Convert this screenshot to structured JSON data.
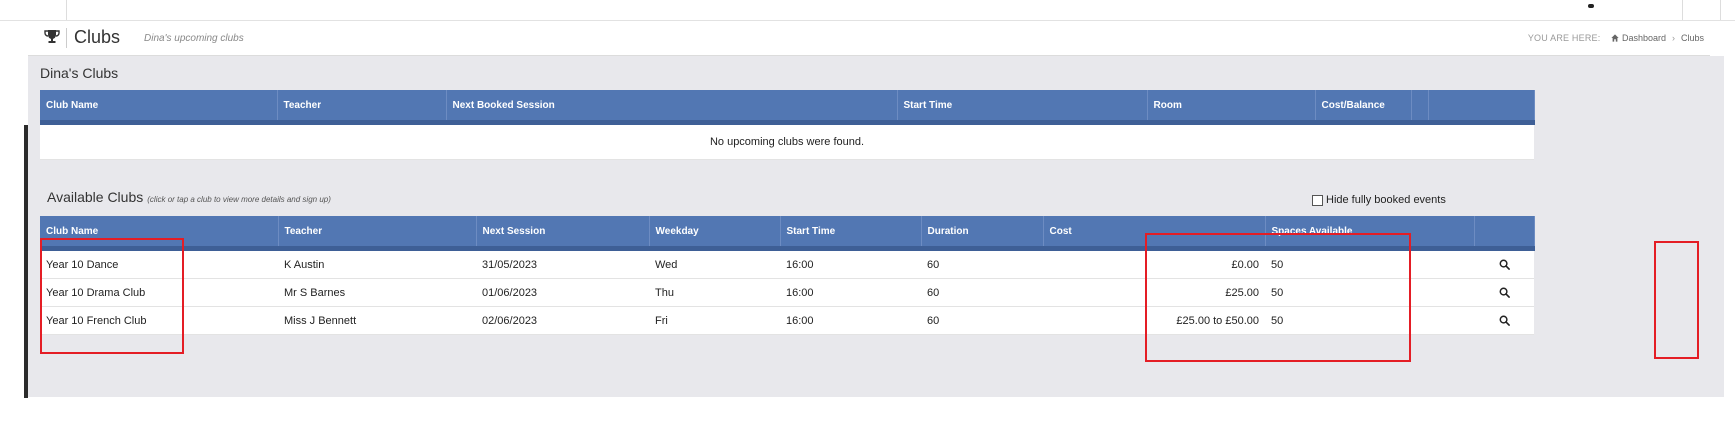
{
  "header": {
    "title": "Clubs",
    "subtitle": "Dina's upcoming clubs",
    "breadcrumb": {
      "label": "YOU ARE HERE:",
      "items": [
        "Dashboard",
        "Clubs"
      ]
    }
  },
  "my_clubs": {
    "title": "Dina's Clubs",
    "columns": [
      "Club Name",
      "Teacher",
      "Next Booked Session",
      "Start Time",
      "Room",
      "Cost/Balance",
      "",
      ""
    ],
    "empty_message": "No upcoming clubs were found."
  },
  "available_clubs": {
    "title": "Available Clubs",
    "hint": "(click or tap a club to view more details and sign up)",
    "hide_full_label": "Hide fully booked events",
    "hide_full_checked": false,
    "columns": [
      "Club Name",
      "Teacher",
      "Next Session",
      "Weekday",
      "Start Time",
      "Duration",
      "Cost",
      "Spaces Available",
      ""
    ],
    "rows": [
      {
        "name": "Year 10 Dance",
        "teacher": "K Austin",
        "next": "31/05/2023",
        "weekday": "Wed",
        "start": "16:00",
        "duration": "60",
        "cost": "£0.00",
        "spaces": "50"
      },
      {
        "name": "Year 10 Drama Club",
        "teacher": "Mr S Barnes",
        "next": "01/06/2023",
        "weekday": "Thu",
        "start": "16:00",
        "duration": "60",
        "cost": "£25.00",
        "spaces": "50"
      },
      {
        "name": "Year 10 French Club",
        "teacher": "Miss J Bennett",
        "next": "02/06/2023",
        "weekday": "Fri",
        "start": "16:00",
        "duration": "60",
        "cost": "£25.00 to £50.00",
        "spaces": "50"
      }
    ]
  },
  "colors": {
    "table_header": "#5277b3",
    "empty_message": "#e00000",
    "annotation": "#e41d25"
  },
  "icons": {
    "page": "trophy-icon",
    "breadcrumb_home": "home-icon",
    "row_action": "search-icon"
  }
}
